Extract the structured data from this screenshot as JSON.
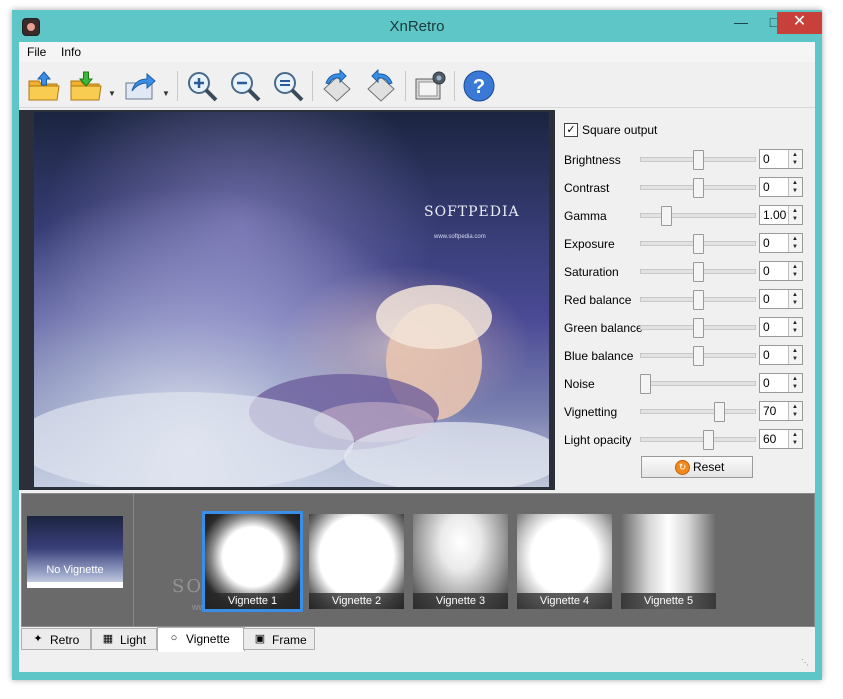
{
  "window": {
    "title": "XnRetro"
  },
  "menu": {
    "items": [
      "File",
      "Info"
    ]
  },
  "toolbar": {
    "icons": [
      "open-file-icon",
      "save-file-icon",
      "export-icon",
      "zoom-in-icon",
      "zoom-out-icon",
      "zoom-fit-icon",
      "rotate-left-icon",
      "rotate-right-icon",
      "screen-capture-icon",
      "help-icon"
    ]
  },
  "preview": {
    "watermark": "SOFTPEDIA",
    "watermark_url": "www.softpedia.com"
  },
  "panel": {
    "square_output": {
      "label": "Square output",
      "checked": true
    },
    "params": [
      {
        "label": "Brightness",
        "value": "0",
        "level": 0.5
      },
      {
        "label": "Contrast",
        "value": "0",
        "level": 0.5
      },
      {
        "label": "Gamma",
        "value": "1.00",
        "level": 0.2
      },
      {
        "label": "Exposure",
        "value": "0",
        "level": 0.5
      },
      {
        "label": "Saturation",
        "value": "0",
        "level": 0.5
      },
      {
        "label": "Red balance",
        "value": "0",
        "level": 0.5
      },
      {
        "label": "Green balance",
        "value": "0",
        "level": 0.5
      },
      {
        "label": "Blue balance",
        "value": "0",
        "level": 0.5
      },
      {
        "label": "Noise",
        "value": "0",
        "level": 0.0
      },
      {
        "label": "Vignetting",
        "value": "70",
        "level": 0.7
      },
      {
        "label": "Light opacity",
        "value": "60",
        "level": 0.6
      }
    ],
    "reset_label": "Reset"
  },
  "strip": {
    "none_label": "No Vignette",
    "items": [
      "Vignette 1",
      "Vignette 2",
      "Vignette 3",
      "Vignette 4",
      "Vignette 5"
    ],
    "selected": 0,
    "watermark": "SOFTPEDIA",
    "watermark_url": "www.softpedia.com"
  },
  "tabs": [
    {
      "label": "Retro",
      "icon": "magic-wand-icon"
    },
    {
      "label": "Light",
      "icon": "light-grid-icon"
    },
    {
      "label": "Vignette",
      "icon": "vignette-icon"
    },
    {
      "label": "Frame",
      "icon": "frame-icon"
    }
  ],
  "active_tab": 2
}
